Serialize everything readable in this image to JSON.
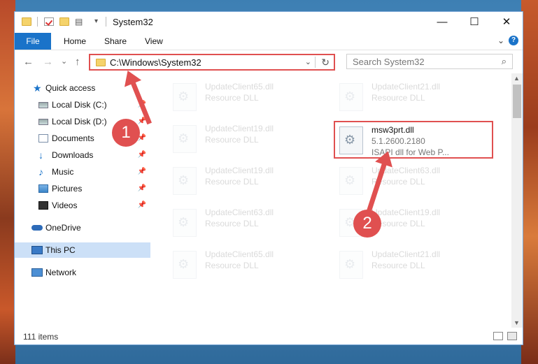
{
  "window": {
    "title": "System32",
    "min_glyph": "—",
    "max_glyph": "☐",
    "close_glyph": "✕"
  },
  "ribbon": {
    "file": "File",
    "home": "Home",
    "share": "Share",
    "view": "View",
    "chevron": "⌄",
    "help": "?"
  },
  "nav": {
    "back": "←",
    "forward": "→",
    "recent": "⌄",
    "up": "↑"
  },
  "address": {
    "path": "C:\\Windows\\System32",
    "dropdown": "⌄",
    "refresh": "↻"
  },
  "search": {
    "placeholder": "Search System32",
    "icon": "⌕"
  },
  "sidebar": {
    "items": [
      {
        "label": "Quick access",
        "icon": "star-icon"
      },
      {
        "label": "Local Disk (C:)",
        "icon": "drive-icon",
        "pinned": true
      },
      {
        "label": "Local Disk (D:)",
        "icon": "drive-icon",
        "pinned": true
      },
      {
        "label": "Documents",
        "icon": "documents-icon",
        "pinned": true
      },
      {
        "label": "Downloads",
        "icon": "download-icon",
        "pinned": true
      },
      {
        "label": "Music",
        "icon": "music-icon",
        "pinned": true
      },
      {
        "label": "Pictures",
        "icon": "pictures-icon",
        "pinned": true
      },
      {
        "label": "Videos",
        "icon": "videos-icon",
        "pinned": true
      },
      {
        "label": "OneDrive",
        "icon": "cloud-icon"
      },
      {
        "label": "This PC",
        "icon": "computer-icon",
        "selected": true
      },
      {
        "label": "Network",
        "icon": "network-icon"
      }
    ],
    "pin_glyph": "📌"
  },
  "files": [
    {
      "name": "UpdateClient65.dll",
      "desc": "Resource DLL"
    },
    {
      "name": "UpdateClient21.dll",
      "desc": "Resource DLL"
    },
    {
      "name": "UpdateClient19.dll",
      "desc": "Resource DLL"
    },
    {
      "name": "msw3prt.dll",
      "desc": "5.1.2600.2180",
      "desc2": "ISAPI dll for Web P..."
    },
    {
      "name": "UpdateClient19.dll",
      "desc": "Resource DLL"
    },
    {
      "name": "UpdateClient63.dll",
      "desc": "Resource DLL"
    },
    {
      "name": "UpdateClient63.dll",
      "desc": "Resource DLL"
    },
    {
      "name": "UpdateClient19.dll",
      "desc": "Resource DLL"
    },
    {
      "name": "UpdateClient65.dll",
      "desc": "Resource DLL"
    },
    {
      "name": "UpdateClient21.dll",
      "desc": "Resource DLL"
    }
  ],
  "status": {
    "items": "111 items"
  },
  "callouts": {
    "one": "1",
    "two": "2"
  },
  "colors": {
    "highlight": "#e05050",
    "accent": "#1a73c9"
  }
}
